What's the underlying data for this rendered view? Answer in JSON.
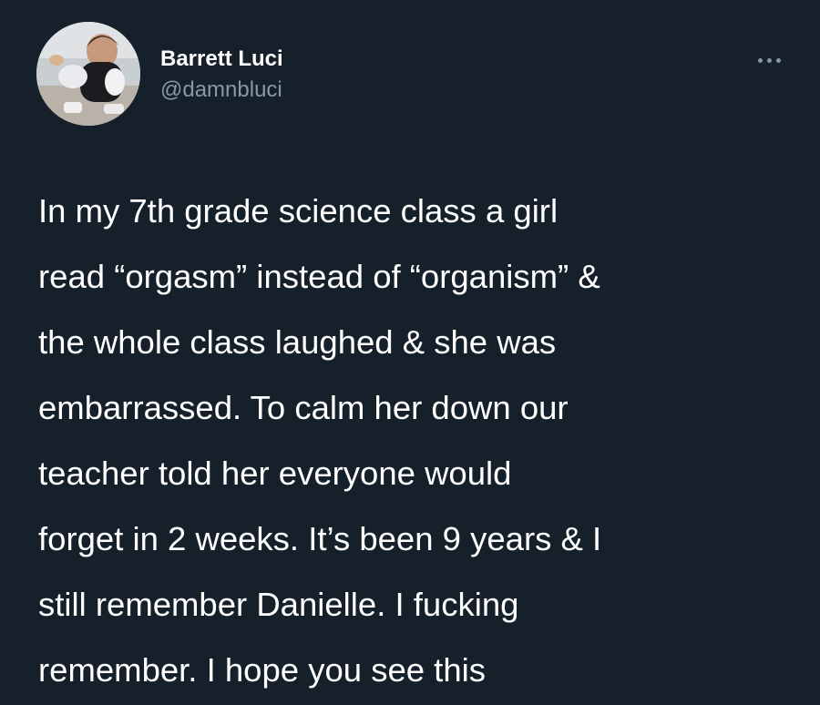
{
  "author": {
    "display_name": "Barrett Luci",
    "handle": "@damnbluci"
  },
  "icons": {
    "more": "more-horizontal-icon",
    "avatar": "profile-photo"
  },
  "colors": {
    "background": "#15202b",
    "text": "#ffffff",
    "secondary_text": "#8899a6"
  },
  "tweet": {
    "lines": [
      "In my 7th grade science class a girl",
      "read “orgasm” instead of “organism” &",
      "the whole class laughed & she was",
      "embarrassed. To calm her down our",
      "teacher told her everyone would",
      "forget in 2 weeks. It’s been 9 years & I",
      "still remember Danielle. I fucking",
      "remember. I hope you see this"
    ]
  }
}
